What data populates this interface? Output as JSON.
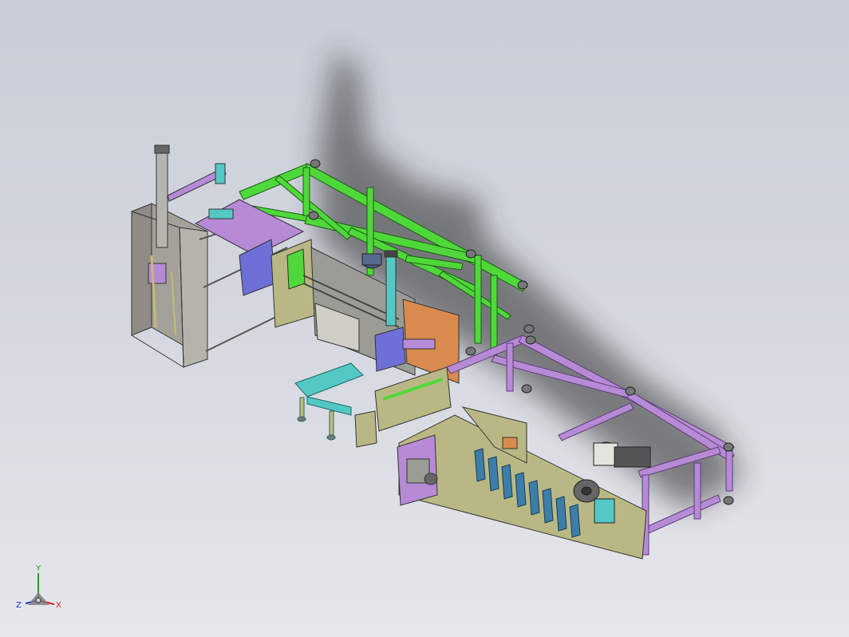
{
  "viewport": {
    "background_top": "#c9ced8",
    "background_bottom": "#e6e7ec"
  },
  "model": {
    "colors": {
      "green_frame": "#4fd83a",
      "purple_frame": "#b78ad6",
      "grey_panel": "#9a9a94",
      "olive_panel": "#b9b884",
      "orange_plate": "#d98a4e",
      "blue_block": "#6f6fd8",
      "teal": "#53c8c4",
      "shadow": "#2b2b2b"
    }
  },
  "triad": {
    "x_label": "X",
    "y_label": "Y",
    "z_label": "Z",
    "x_color": "#d82020",
    "y_color": "#20a020",
    "z_color": "#2030d0"
  }
}
